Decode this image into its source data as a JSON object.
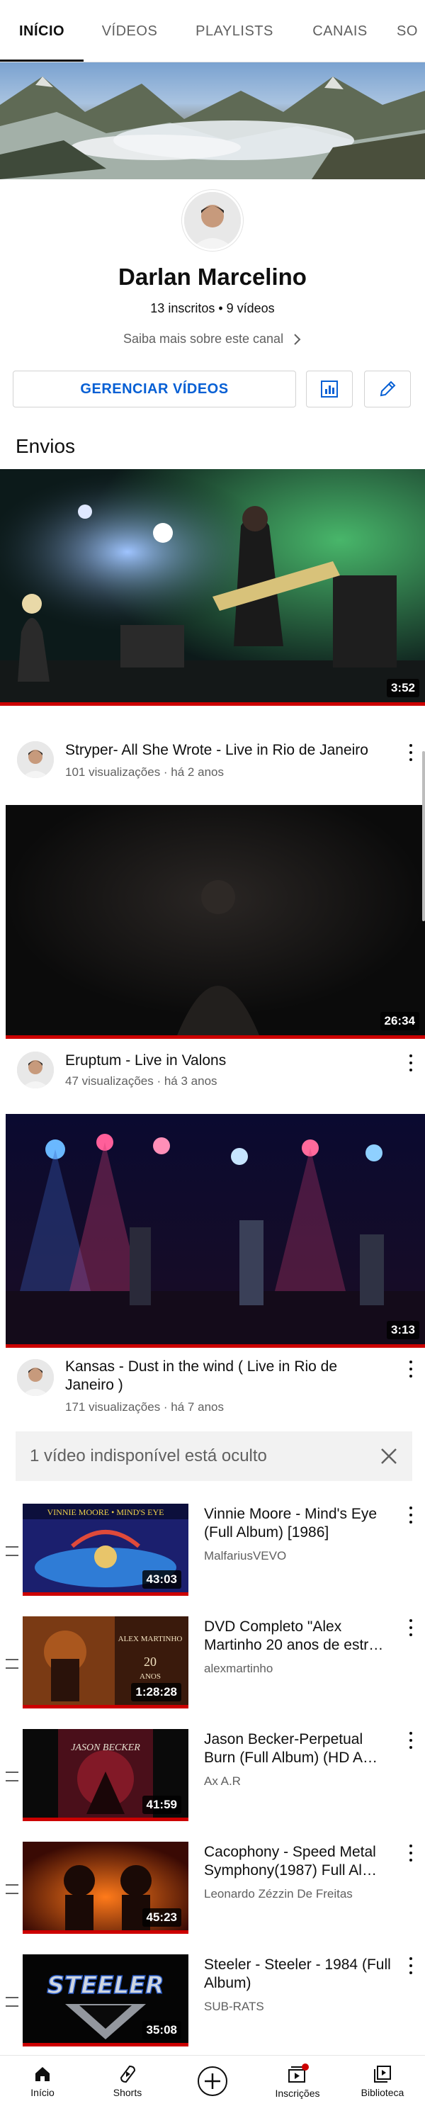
{
  "tabs": [
    "INÍCIO",
    "VÍDEOS",
    "PLAYLISTS",
    "CANAIS",
    "SO"
  ],
  "channel": {
    "name": "Darlan Marcelino",
    "stats": "13 inscritos • 9 vídeos",
    "about": "Saiba mais sobre este canal",
    "manage_button": "GERENCIAR VÍDEOS"
  },
  "section_title": "Envios",
  "videos": [
    {
      "title": "Stryper- All She Wrote - Live in Rio de Janeiro",
      "meta": "101 visualizações · há 2 anos",
      "duration": "3:52"
    },
    {
      "title": "Eruptum - Live in Valons",
      "meta": "47 visualizações · há 3 anos",
      "duration": "26:34"
    },
    {
      "title": "Kansas - Dust in the wind ( Live in Rio de Janeiro )",
      "meta": "171 visualizações · há 7 anos",
      "duration": "3:13"
    }
  ],
  "hidden_notice": "1 vídeo indisponível está oculto",
  "playlist": [
    {
      "title": "Vinnie Moore - Mind's Eye (Full Album) [1986]",
      "channel": "MalfariusVEVO",
      "duration": "43:03",
      "cover_text": "VINNIE MOORE • MIND'S EYE"
    },
    {
      "title": "DVD Completo \"Alex Martinho 20 anos de estr…",
      "channel": "alexmartinho",
      "duration": "1:28:28",
      "cover_text": "ALEX MARTINHO 20 ANOS"
    },
    {
      "title": "Jason Becker-Perpetual Burn (Full Album) (HD A…",
      "channel": "Ax A.R",
      "duration": "41:59",
      "cover_text": "JASON BECKER"
    },
    {
      "title": "Cacophony - Speed Metal Symphony(1987) Full Al…",
      "channel": "Leonardo Zézzin De Freitas",
      "duration": "45:23",
      "cover_text": ""
    },
    {
      "title": "Steeler - Steeler - 1984 (Full Album)",
      "channel": "SUB-RATS",
      "duration": "35:08",
      "cover_text": "STEELER"
    }
  ],
  "nav": [
    "Início",
    "Shorts",
    "",
    "Inscrições",
    "Biblioteca"
  ],
  "colors": {
    "accent_red": "#cc0000",
    "link_blue": "#065fd4",
    "text": "#0f0f0f",
    "muted": "#606060"
  }
}
